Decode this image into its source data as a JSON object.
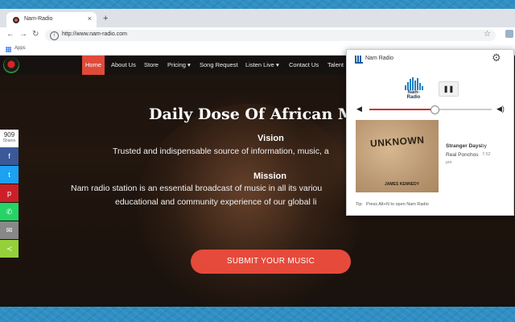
{
  "browser": {
    "tab_title": "Nam-Radio",
    "tab_close": "×",
    "new_tab": "+",
    "back": "←",
    "forward": "→",
    "reload": "↻",
    "info": "i",
    "url": "http://www.nam-radio.com",
    "star": "☆",
    "bookmarks_apps": "Apps"
  },
  "site": {
    "menu": [
      {
        "label": "Home",
        "active": true
      },
      {
        "label": "About Us"
      },
      {
        "label": "Store"
      },
      {
        "label": "Pricing ▾"
      },
      {
        "label": "Song Request"
      },
      {
        "label": "Listen Live ▾"
      },
      {
        "label": "Contact Us"
      },
      {
        "label": "Talent"
      }
    ],
    "hero_title": "Daily Dose Of African M",
    "vision_heading": "Vision",
    "vision_text": "Trusted and indispensable source of information, music, a",
    "mission_heading": "Mission",
    "mission_text_1": "Nam radio station is an essential broadcast of music in all its variou",
    "mission_text_2": "educational and community experience of our global li",
    "submit_label": "SUBMIT YOUR MUSIC"
  },
  "share_bar": {
    "count": "909",
    "count_label": "Shares",
    "buttons": [
      {
        "name": "facebook",
        "glyph": "f",
        "color": "#3b5998"
      },
      {
        "name": "twitter",
        "glyph": "t",
        "color": "#1da1f2"
      },
      {
        "name": "pinterest",
        "glyph": "p",
        "color": "#cb2027"
      },
      {
        "name": "whatsapp",
        "glyph": "✆",
        "color": "#25d366"
      },
      {
        "name": "email",
        "glyph": "✉",
        "color": "#888888"
      },
      {
        "name": "sharethis",
        "glyph": "≺",
        "color": "#95d03a"
      }
    ]
  },
  "popup": {
    "title": "Nam Radio",
    "gear": "⚙",
    "logo_text": "Nam-Radio",
    "pause_glyph": "❚❚",
    "volume_low_glyph": "◀",
    "volume_high_glyph": "◀)",
    "volume": 0.53,
    "album_top": "UNKNOWN",
    "album_bottom": "JAMES KENNEDY",
    "track_title": "Stranger Days",
    "track_by": "by",
    "track_artist": "Real Ponchos",
    "track_time_1": "7:52",
    "track_time_2": "pm",
    "tip_label": "Tip:",
    "tip_text": "Press Alt+N to open Nam Radio"
  },
  "colors": {
    "accent_red": "#e04a3a",
    "volume_fill": "#d32f2f",
    "logo_blue": "#1d7fc4"
  }
}
